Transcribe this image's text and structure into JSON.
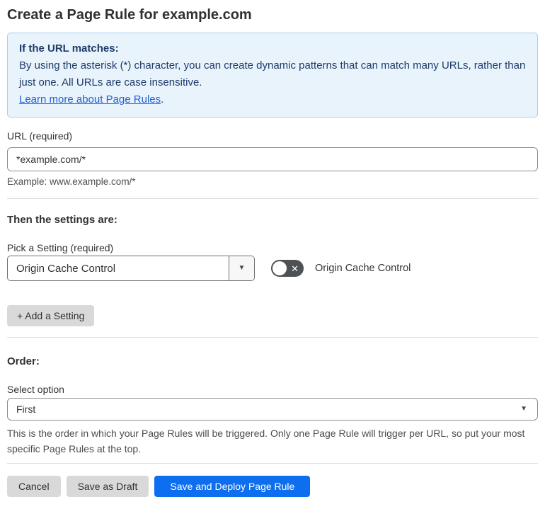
{
  "page": {
    "title": "Create a Page Rule for example.com"
  },
  "info_box": {
    "heading": "If the URL matches:",
    "body": "By using the asterisk (*) character, you can create dynamic patterns that can match many URLs, rather than just one. All URLs are case insensitive.",
    "link_label": "Learn more about Page Rules",
    "link_suffix": "."
  },
  "url_field": {
    "label": "URL (required)",
    "value": "*example.com/*",
    "example": "Example: www.example.com/*"
  },
  "settings_section": {
    "heading": "Then the settings are:",
    "picker_label": "Pick a Setting (required)",
    "picker_value": "Origin Cache Control",
    "picker_caret": "▼",
    "toggle_state": "off",
    "toggle_off_glyph": "✕",
    "toggle_label": "Origin Cache Control",
    "add_setting_label": "+ Add a Setting"
  },
  "order_section": {
    "heading": "Order:",
    "select_label": "Select option",
    "select_value": "First",
    "select_caret": "▼",
    "help_text": "This is the order in which your Page Rules will be triggered. Only one Page Rule will trigger per URL, so put your most specific Page Rules at the top."
  },
  "footer": {
    "cancel_label": "Cancel",
    "save_draft_label": "Save as Draft",
    "save_deploy_label": "Save and Deploy Page Rule"
  },
  "colors": {
    "primary_blue": "#0d6ef0",
    "info_background": "#e9f3fc",
    "info_border": "#a8cdee",
    "info_text": "#1c3c69",
    "link_blue": "#2062d4",
    "toggle_off_background": "#4f5255",
    "gray_button": "#d9d9d9",
    "divider": "#dedede"
  }
}
